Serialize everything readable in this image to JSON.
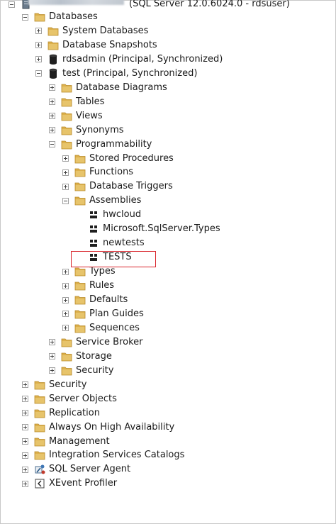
{
  "server": {
    "name_suffix": "(SQL Server 12.0.6024.0 - rdsuser)"
  },
  "tree": [
    {
      "label": "Databases",
      "icon": "folder-icon",
      "state": "expanded"
    },
    {
      "label": "System Databases",
      "icon": "folder-icon",
      "state": "collapsed"
    },
    {
      "label": "Database Snapshots",
      "icon": "folder-icon",
      "state": "collapsed"
    },
    {
      "label": "rdsadmin (Principal, Synchronized)",
      "icon": "database-icon",
      "state": "collapsed"
    },
    {
      "label": "test (Principal, Synchronized)",
      "icon": "database-icon",
      "state": "expanded"
    },
    {
      "label": "Database Diagrams",
      "icon": "folder-icon",
      "state": "collapsed"
    },
    {
      "label": "Tables",
      "icon": "folder-icon",
      "state": "collapsed"
    },
    {
      "label": "Views",
      "icon": "folder-icon",
      "state": "collapsed"
    },
    {
      "label": "Synonyms",
      "icon": "folder-icon",
      "state": "collapsed"
    },
    {
      "label": "Programmability",
      "icon": "folder-icon",
      "state": "expanded"
    },
    {
      "label": "Stored Procedures",
      "icon": "folder-icon",
      "state": "collapsed"
    },
    {
      "label": "Functions",
      "icon": "folder-icon",
      "state": "collapsed"
    },
    {
      "label": "Database Triggers",
      "icon": "folder-icon",
      "state": "collapsed"
    },
    {
      "label": "Assemblies",
      "icon": "folder-icon",
      "state": "expanded"
    },
    {
      "label": "hwcloud",
      "icon": "assembly-icon",
      "state": "leaf"
    },
    {
      "label": "Microsoft.SqlServer.Types",
      "icon": "assembly-icon",
      "state": "leaf"
    },
    {
      "label": "newtests",
      "icon": "assembly-icon",
      "state": "leaf"
    },
    {
      "label": "TESTS",
      "icon": "assembly-icon",
      "state": "leaf"
    },
    {
      "label": "Types",
      "icon": "folder-icon",
      "state": "collapsed"
    },
    {
      "label": "Rules",
      "icon": "folder-icon",
      "state": "collapsed"
    },
    {
      "label": "Defaults",
      "icon": "folder-icon",
      "state": "collapsed"
    },
    {
      "label": "Plan Guides",
      "icon": "folder-icon",
      "state": "collapsed"
    },
    {
      "label": "Sequences",
      "icon": "folder-icon",
      "state": "collapsed"
    },
    {
      "label": "Service Broker",
      "icon": "folder-icon",
      "state": "collapsed"
    },
    {
      "label": "Storage",
      "icon": "folder-icon",
      "state": "collapsed"
    },
    {
      "label": "Security",
      "icon": "folder-icon",
      "state": "collapsed"
    },
    {
      "label": "Security",
      "icon": "folder-icon",
      "state": "collapsed"
    },
    {
      "label": "Server Objects",
      "icon": "folder-icon",
      "state": "collapsed"
    },
    {
      "label": "Replication",
      "icon": "folder-icon",
      "state": "collapsed"
    },
    {
      "label": "Always On High Availability",
      "icon": "folder-icon",
      "state": "collapsed"
    },
    {
      "label": "Management",
      "icon": "folder-icon",
      "state": "collapsed"
    },
    {
      "label": "Integration Services Catalogs",
      "icon": "folder-icon",
      "state": "collapsed"
    },
    {
      "label": "SQL Server Agent",
      "icon": "agent-icon",
      "state": "collapsed"
    },
    {
      "label": "XEvent Profiler",
      "icon": "profiler-icon",
      "state": "collapsed"
    }
  ],
  "colors": {
    "folder": "#dcb04c",
    "folder_dark": "#b98a2a",
    "highlight_border": "#d9242b"
  }
}
